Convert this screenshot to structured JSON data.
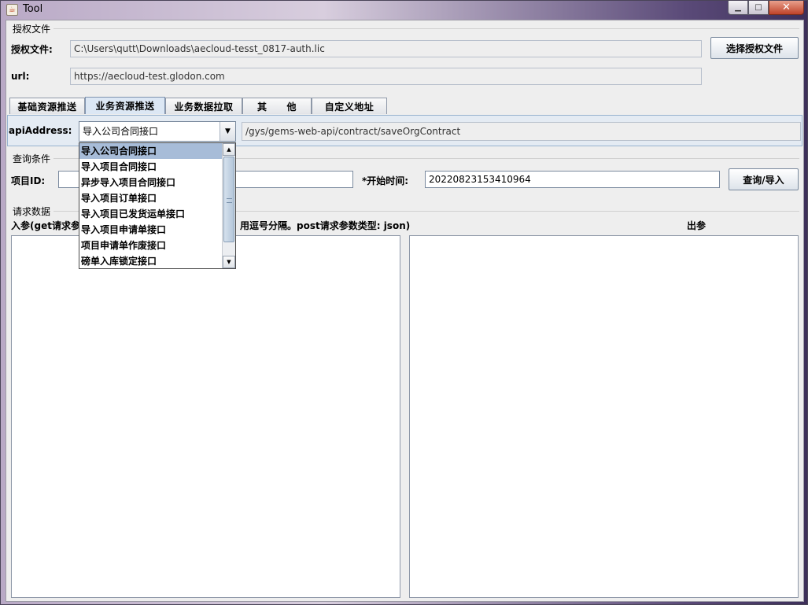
{
  "window": {
    "title": "Tool"
  },
  "auth": {
    "group_label": "授权文件",
    "file_label": "授权文件:",
    "file_value": "C:\\Users\\qutt\\Downloads\\aecloud-tesst_0817-auth.lic",
    "choose_button": "选择授权文件",
    "url_label": "url:",
    "url_value": "https://aecloud-test.glodon.com"
  },
  "tabs": [
    {
      "label": "基础资源推送"
    },
    {
      "label": "业务资源推送"
    },
    {
      "label": "业务数据拉取"
    },
    {
      "label": "其　　他"
    },
    {
      "label": "自定义地址"
    }
  ],
  "api": {
    "label": "apiAddress:",
    "selected": "导入公司合同接口",
    "path": "/gys/gems-web-api/contract/saveOrgContract",
    "options": [
      "导入公司合同接口",
      "导入项目合同接口",
      "异步导入项目合同接口",
      "导入项目订单接口",
      "导入项目已发货运单接口",
      "导入项目申请单接口",
      "项目申请单作废接口",
      "磅单入库锁定接口"
    ]
  },
  "query": {
    "group_label": "查询条件",
    "project_label": "项目ID:",
    "project_value": "",
    "start_label": "*开始时间:",
    "start_value": "20220823153410964",
    "button": "查询/导入"
  },
  "request": {
    "group_label": "请求数据",
    "input_label_left": "入参(get请求参",
    "input_label_right": "用逗号分隔。post请求参数类型: json)",
    "output_label": "出参"
  }
}
